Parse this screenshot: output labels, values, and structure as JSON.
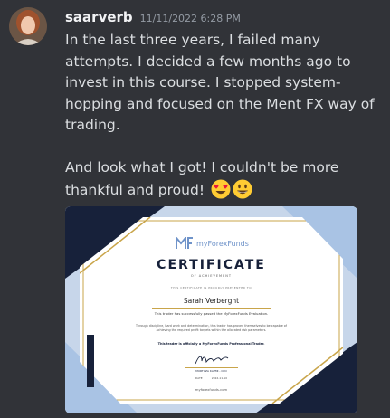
{
  "message": {
    "username": "saarverb",
    "timestamp": "11/11/2022 6:28 PM",
    "paragraph1": "In the last three years, I failed many attempts. I decided a few months ago to invest in this course. I stopped system-hopping and focused on the Ment FX way of trading.",
    "paragraph2": "And look what I got! I couldn't be more thankful and proud!",
    "emojis": [
      "heart-eyes-emoji-icon",
      "grinning-face-emoji-icon"
    ]
  },
  "attachment": {
    "brand": "myForexFunds",
    "title": "CERTIFICATE",
    "subtitle": "OF ACHIEVEMENT",
    "presented_line": "THIS CERTIFICATE IS PROUDLY PRESENTED TO",
    "recipient": "Sarah Verberght",
    "passed_line": "This trader has successfully passed the MyForexFunds Evaluation.",
    "body_text": "Through discipline, hard work and determination, this trader has proven themselves to be capable of achieving the required profit targets within the allocated risk parameters.",
    "official_line": "This trader is officially a MyForexFunds Professional Trader.",
    "signer": "MURTUZA KAZMI - CEO",
    "date_label": "DATE",
    "date_value": "2022-11-10",
    "website": "myforexfunds.com",
    "colors": {
      "navy": "#17213a",
      "gold": "#c9a54a",
      "blue": "#a9c3e4"
    }
  }
}
